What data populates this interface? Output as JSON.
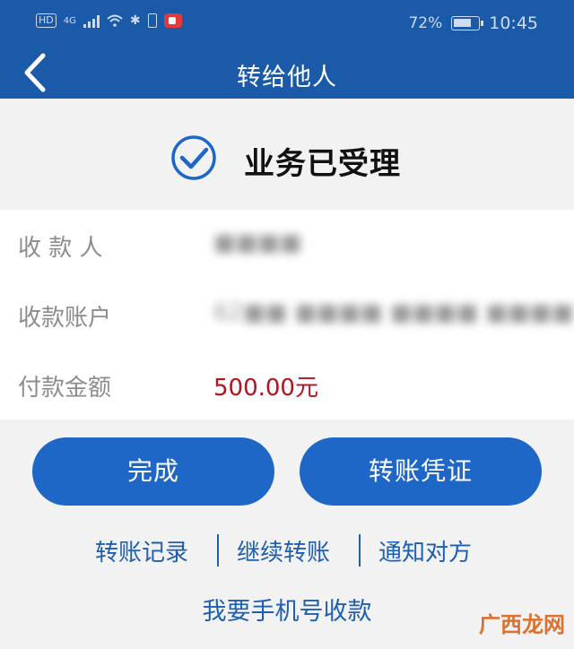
{
  "status_bar": {
    "hd": "HD",
    "network": "4G",
    "battery_pct": "72%",
    "time": "10:45"
  },
  "nav": {
    "title": "转给他人",
    "back_icon": "chevron-left-icon"
  },
  "result": {
    "title": "业务已受理",
    "icon": "check-circle-icon",
    "accent_color": "#1f67c7"
  },
  "details": {
    "payee_label": "收 款 人",
    "payee_value": "■■■■",
    "account_label": "收款账户",
    "account_value": "62■■ ■■■■ ■■■■ ■■■■",
    "amount_label": "付款金额",
    "amount_value": "500.00元",
    "amount_color": "#b3131d"
  },
  "actions": {
    "done_label": "完成",
    "receipt_label": "转账凭证"
  },
  "links": {
    "history": "转账记录",
    "continue": "继续转账",
    "notify": "通知对方",
    "phone_receive": "我要手机号收款"
  },
  "watermark": {
    "text": "广西龙网"
  }
}
